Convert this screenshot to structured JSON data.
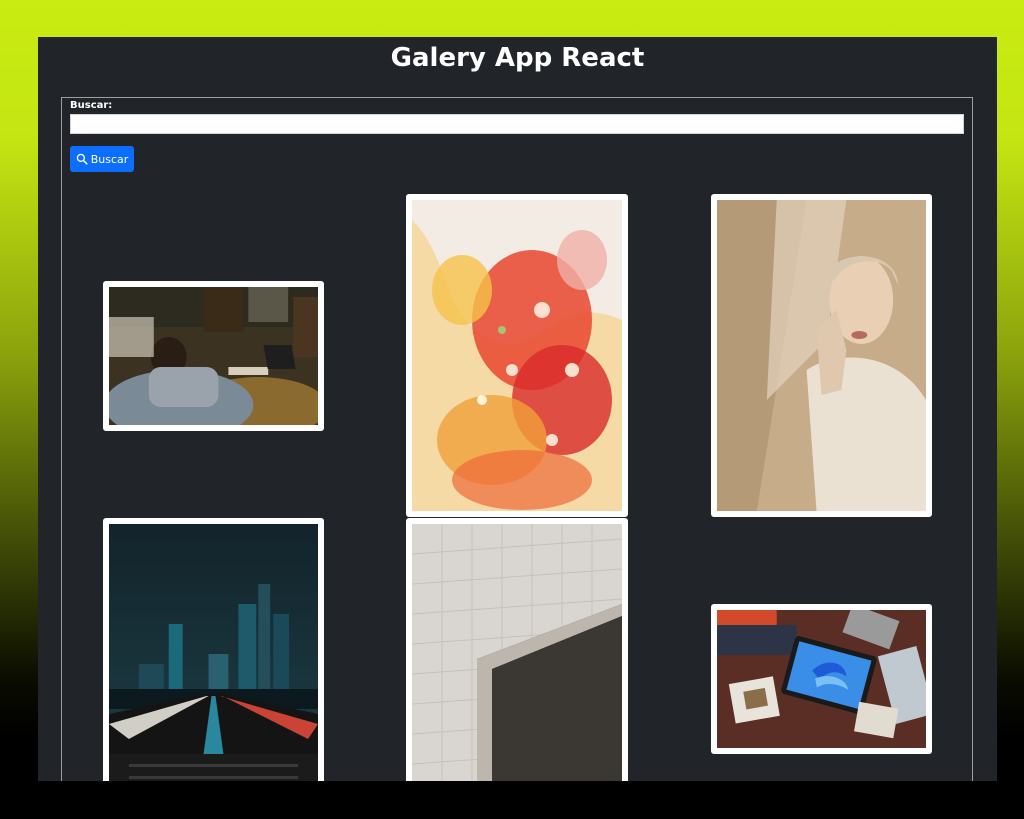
{
  "header": {
    "title": "Galery App React"
  },
  "search": {
    "label": "Buscar:",
    "value": "",
    "placeholder": "",
    "button_label": "Buscar",
    "button_icon": "search-icon"
  },
  "colors": {
    "page_top": "#c9ec12",
    "app_bg": "#212529",
    "button": "#0d6efd"
  },
  "gallery": {
    "photos": [
      {
        "subject": "woman-laptop-bed"
      },
      {
        "subject": "abstract-fluid-art"
      },
      {
        "subject": "woman-portrait-beige"
      },
      {
        "subject": "city-night-light-trails"
      },
      {
        "subject": "white-building-facade"
      },
      {
        "subject": "tablet-on-table"
      }
    ]
  }
}
